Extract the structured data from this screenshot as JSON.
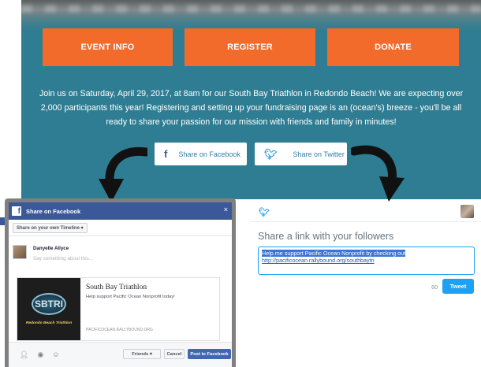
{
  "nav": {
    "event_info": "EVENT INFO",
    "register": "REGISTER",
    "donate": "DONATE"
  },
  "banner": {
    "text": "Join us on Saturday, April 29, 2017, at 8am for our South Bay Triathlon in Redondo Beach! We are expecting over 2,000 participants this year! Registering and setting up your fundraising page is an (ocean's) breeze - you'll be all ready to share your passion for our mission with friends and family in minutes!"
  },
  "share": {
    "facebook_label": "Share on Facebook",
    "twitter_label": "Share on Twitter"
  },
  "facebook_dialog": {
    "title": "Share on Facebook",
    "close": "×",
    "timeline_select": "Share on your own Timeline ▾",
    "user_name": "Danyelle Allyce",
    "say_placeholder": "Say something about this...",
    "card_title": "South Bay Triathlon",
    "card_description": "Help support Pacific Ocean Nonprofit today!",
    "card_url": "PACIFICOCEAN.RALLYBOUND.ORG",
    "logo_text": "SBTRI",
    "logo_caption": "Redondo Beach Triathlon",
    "friends_button": "Friends ▾",
    "cancel_button": "Cancel",
    "post_button": "Post to Facebook"
  },
  "twitter_dialog": {
    "heading": "Share a link with your followers",
    "tweet_text_selected": "Help me support Pacific Ocean Nonprofit by checking out",
    "tweet_link": "http://pacificocean.rallybound.org/southbaytri",
    "char_count": "60",
    "tweet_button": "Tweet"
  },
  "colors": {
    "banner_bg": "#2e7d93",
    "nav_orange": "#f26b2a",
    "facebook_blue": "#3b5998",
    "facebook_post": "#4267b2",
    "twitter_blue": "#1da1f2"
  },
  "icons": {
    "facebook": "facebook-icon",
    "twitter": "twitter-bird-icon",
    "arrow": "curved-arrow-icon"
  }
}
